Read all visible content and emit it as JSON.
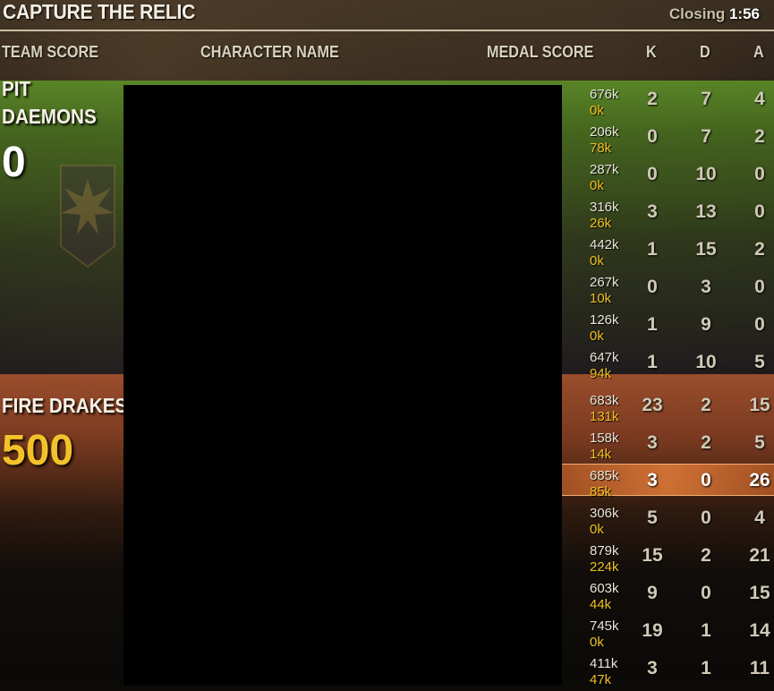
{
  "title": "CAPTURE THE RELIC",
  "closing": {
    "label": "Closing",
    "time": "1:56"
  },
  "columns": {
    "team_score": "TEAM SCORE",
    "character_name": "CHARACTER NAME",
    "medal_score": "MEDAL SCORE",
    "k": "K",
    "d": "D",
    "a": "A"
  },
  "teams": [
    {
      "name_line1": "PIT",
      "name_line2": "DAEMONS",
      "score": "0",
      "color": "#5c8c28",
      "score_color": "#ffffff",
      "emblem": "phoenix-banner-icon",
      "players": [
        {
          "medal": "676k",
          "sub": "0k",
          "k": "2",
          "d": "7",
          "a": "4"
        },
        {
          "medal": "206k",
          "sub": "78k",
          "k": "0",
          "d": "7",
          "a": "2"
        },
        {
          "medal": "287k",
          "sub": "0k",
          "k": "0",
          "d": "10",
          "a": "0"
        },
        {
          "medal": "316k",
          "sub": "26k",
          "k": "3",
          "d": "13",
          "a": "0"
        },
        {
          "medal": "442k",
          "sub": "0k",
          "k": "1",
          "d": "15",
          "a": "2"
        },
        {
          "medal": "267k",
          "sub": "10k",
          "k": "0",
          "d": "3",
          "a": "0"
        },
        {
          "medal": "126k",
          "sub": "0k",
          "k": "1",
          "d": "9",
          "a": "0"
        },
        {
          "medal": "647k",
          "sub": "94k",
          "k": "1",
          "d": "10",
          "a": "5"
        }
      ]
    },
    {
      "name_line1": "FIRE DRAKES",
      "name_line2": "",
      "score": "500",
      "color": "#a0502d",
      "score_color": "#f3c22a",
      "players": [
        {
          "medal": "683k",
          "sub": "131k",
          "k": "23",
          "d": "2",
          "a": "15"
        },
        {
          "medal": "158k",
          "sub": "14k",
          "k": "3",
          "d": "2",
          "a": "5"
        },
        {
          "medal": "685k",
          "sub": "85k",
          "k": "3",
          "d": "0",
          "a": "26",
          "highlight": true
        },
        {
          "medal": "306k",
          "sub": "0k",
          "k": "5",
          "d": "0",
          "a": "4"
        },
        {
          "medal": "879k",
          "sub": "224k",
          "k": "15",
          "d": "2",
          "a": "21"
        },
        {
          "medal": "603k",
          "sub": "44k",
          "k": "9",
          "d": "0",
          "a": "15"
        },
        {
          "medal": "745k",
          "sub": "0k",
          "k": "19",
          "d": "1",
          "a": "14"
        },
        {
          "medal": "411k",
          "sub": "47k",
          "k": "3",
          "d": "1",
          "a": "11"
        }
      ]
    }
  ]
}
